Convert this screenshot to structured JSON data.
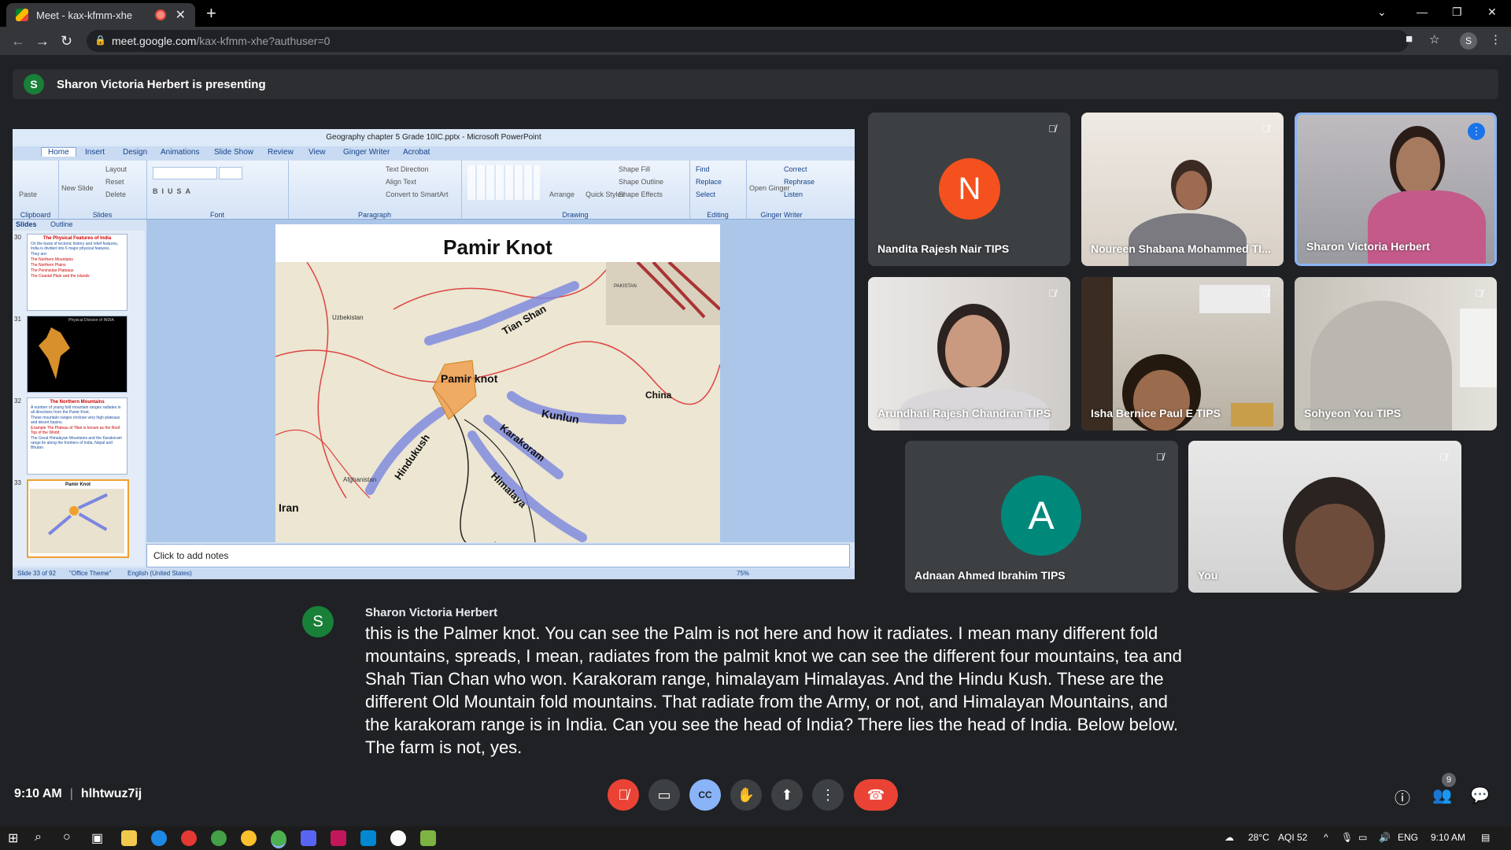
{
  "browser": {
    "tab_title": "Meet - kax-kfmm-xhe",
    "url_host": "meet.google.com",
    "url_path": "/kax-kfmm-xhe?authuser=0",
    "profile_initial": "S"
  },
  "banner": {
    "initial": "S",
    "text": "Sharon Victoria Herbert is presenting"
  },
  "powerpoint": {
    "window_title": "Geography chapter 5 Grade 10IC.pptx - Microsoft PowerPoint",
    "tabs": [
      "Home",
      "Insert",
      "Design",
      "Animations",
      "Slide Show",
      "Review",
      "View",
      "Ginger Writer",
      "Acrobat"
    ],
    "groups": {
      "clipboard": "Clipboard",
      "slides": "Slides",
      "font": "Font",
      "paragraph": "Paragraph",
      "drawing": "Drawing",
      "editing": "Editing",
      "ginger": "Ginger Writer"
    },
    "ribbon_items": {
      "paste": "Paste",
      "new_slide": "New Slide",
      "layout": "Layout",
      "reset": "Reset",
      "delete": "Delete",
      "text_direction": "Text Direction",
      "align_text": "Align Text",
      "convert_smartart": "Convert to SmartArt",
      "arrange": "Arrange",
      "quick_styles": "Quick Styles",
      "shape_fill": "Shape Fill",
      "shape_outline": "Shape Outline",
      "shape_effects": "Shape Effects",
      "find": "Find",
      "replace": "Replace",
      "select": "Select",
      "open_ginger": "Open Ginger",
      "correct": "Correct",
      "rephrase": "Rephrase",
      "listen": "Listen"
    },
    "pane_tabs": [
      "Slides",
      "Outline"
    ],
    "thumbs": [
      {
        "num": "30",
        "title": "The Physical Features of India",
        "lines": [
          "On the basis of tectonic history and relief features, India is divided into 6 major physical features.",
          "They are:",
          "The Northern Mountains",
          "The Northern Plains",
          "The Peninsular Plateaus",
          "The Coastal Plain and the Islands"
        ]
      },
      {
        "num": "31",
        "title": "Physical Division of INDIA"
      },
      {
        "num": "32",
        "title": "The Northern Mountains",
        "lines": [
          "A number of young fold mountain ranges radiates in all directions from the Pamir Knot.",
          "These mountain ranges enclose very high plateaus and desert basins.",
          "Example The Plateau of Tibet is known as the Roof Top of the World.",
          "The Great Himalayan Mountains and the Karakoram range lie along the frontiers of India, Nepal and Bhutan."
        ]
      },
      {
        "num": "33",
        "title": "Pamir Knot"
      }
    ],
    "slide_title": "Pamir Knot",
    "map_labels": {
      "pamir": "Pamir knot",
      "tian_shan": "Tian Shan",
      "kunlun": "Kunlun",
      "karakoram": "Karakoram",
      "himalaya": "Himalaya",
      "hindukush": "Hindukush",
      "china": "China",
      "iran": "Iran",
      "afghanistan": "Afghanistan",
      "uzbekistan": "Uzbekistan",
      "pakistan": "PAKISTAN"
    },
    "notes_placeholder": "Click to add notes",
    "status": {
      "slide": "Slide 33 of 92",
      "theme": "\"Office Theme\"",
      "language": "English (United States)",
      "zoom": "75%"
    }
  },
  "participants": [
    {
      "name": "Nandita Rajesh Nair TIPS",
      "initial": "N",
      "color": "#f4511e",
      "muted": true,
      "video": false
    },
    {
      "name": "Noureen Shabana Mohammed TI...",
      "muted": true,
      "video": true
    },
    {
      "name": "Sharon Victoria Herbert",
      "muted": false,
      "video": true,
      "speaking": true
    },
    {
      "name": "Arundhati Rajesh Chandran TIPS",
      "muted": true,
      "video": true
    },
    {
      "name": "Isha Bernice Paul E TIPS",
      "muted": true,
      "video": true
    },
    {
      "name": "Sohyeon You TIPS",
      "muted": true,
      "video": true
    },
    {
      "name": "Adnaan Ahmed Ibrahim TIPS",
      "initial": "A",
      "color": "#00897b",
      "muted": true,
      "video": false
    },
    {
      "name": "You",
      "muted": true,
      "video": true
    }
  ],
  "caption": {
    "initial": "S",
    "speaker": "Sharon Victoria Herbert",
    "text": "this is the Palmer knot. You can see the Palm is not here and how it radiates. I mean many different fold mountains, spreads, I mean, radiates from the palmit knot we can see the different four mountains, tea and Shah Tian Chan who won. Karakoram range, himalayam Himalayas. And the Hindu Kush. These are the different Old Mountain fold mountains. That radiate from the Army, or not, and Himalayan Mountains, and the karakoram range is in India. Can you see the head of India? There lies the head of India. Below below. The farm is not, yes."
  },
  "meeting": {
    "time": "9:10 AM",
    "code": "hlhtwuz7ij",
    "people_count": "9"
  },
  "taskbar": {
    "weather": "28°C",
    "aqi": "AQI 52",
    "lang": "ENG",
    "time": "9:10 AM"
  },
  "colors": {
    "meet_bg": "#202124",
    "tile_bg": "#3c4043",
    "end_call": "#ea4335",
    "active_speaker_border": "#8ab4f8"
  }
}
